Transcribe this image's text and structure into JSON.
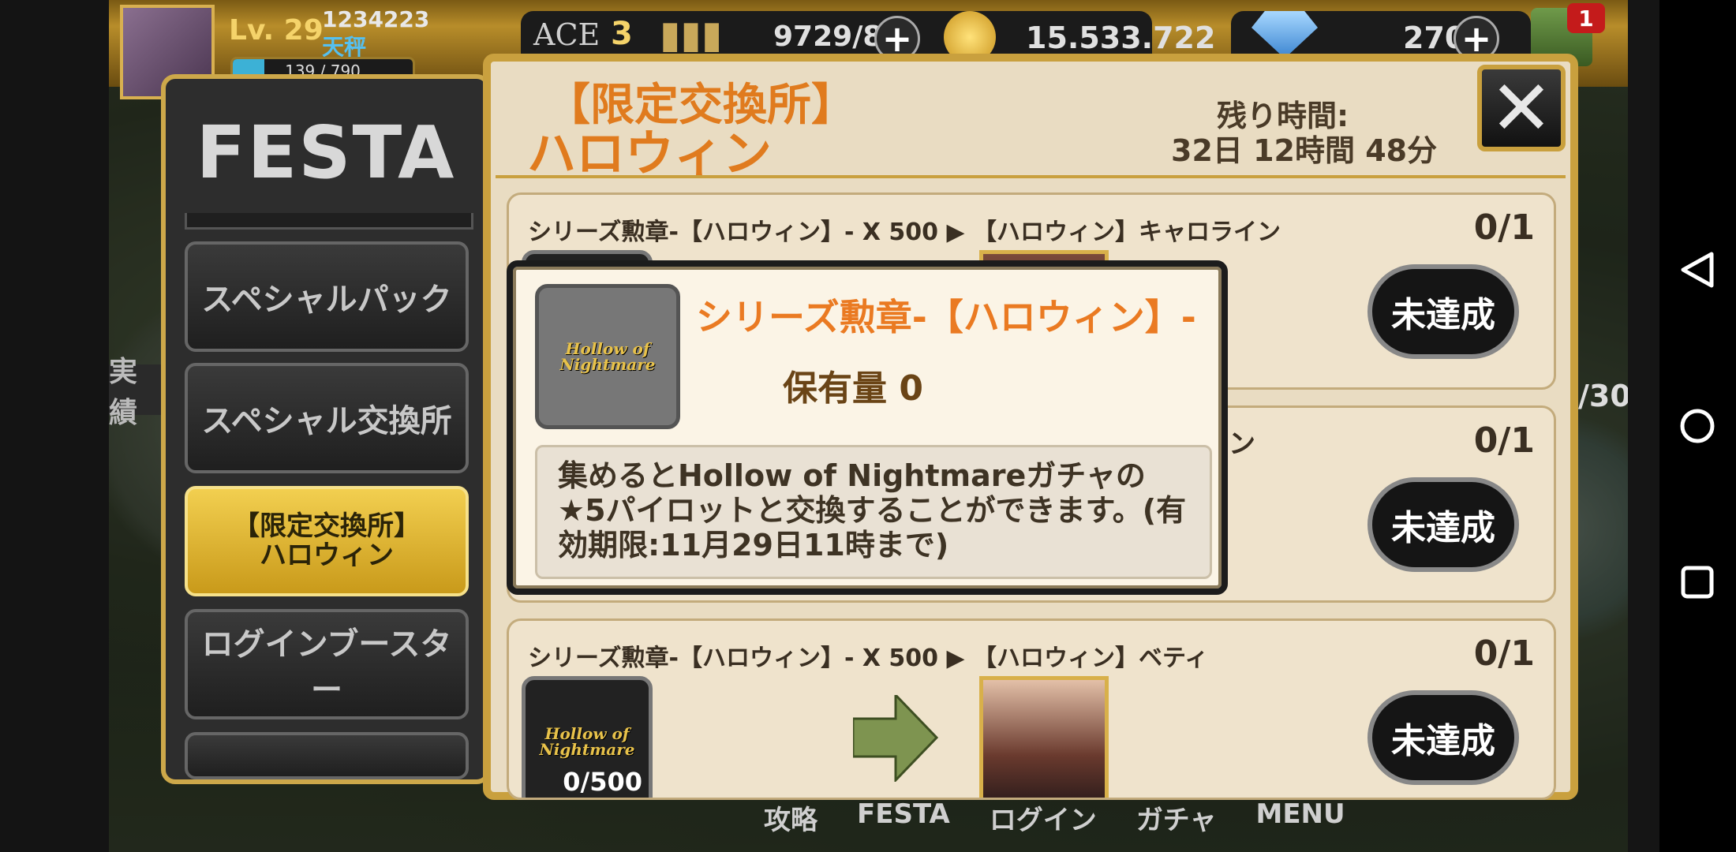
{
  "player": {
    "level": "Lv. 29",
    "id": "1234223",
    "name": "天秤",
    "exp": "139 / 790"
  },
  "topbar": {
    "ace_label": "ACE",
    "ace_value": "3",
    "ammo": "9729/88",
    "coins": "15.533.722",
    "gems": "270",
    "army_badge": "1"
  },
  "festa": {
    "title": "FESTA",
    "menu": [
      {
        "label": "スペシャルパック"
      },
      {
        "label": "スペシャル交換所"
      },
      {
        "label": "【限定交換所】\nハロウィン"
      },
      {
        "label": "ログインブースター"
      }
    ]
  },
  "background": {
    "left_partial_text": "実績",
    "right_partial_text": "/30"
  },
  "dialog": {
    "title_line1": "【限定交換所】",
    "title_line2": "ハロウィン",
    "remaining_label": "残り時間:",
    "remaining_value": "32日 12時間 48分",
    "rows": [
      {
        "title": "シリーズ勲章-【ハロウィン】- X 500 ▶ 【ハロウィン】キャロライン",
        "count": "0/1",
        "status": "未達成"
      },
      {
        "title_partial": "ン",
        "count": "0/1",
        "status": "未達成"
      },
      {
        "title": "シリーズ勲章-【ハロウィン】- X 500 ▶ 【ハロウィン】ベティ",
        "count": "0/1",
        "status": "未達成",
        "medal_progress": "0/500"
      }
    ]
  },
  "popup": {
    "item_name": "シリーズ勲章-【ハロウィン】-",
    "held_label": "保有量 0",
    "medal_logo_line1": "Hollow of",
    "medal_logo_line2": "Nightmare",
    "description": "集めるとHollow of Nightmareガチャの★5パイロットと交換することができます。(有効期限:11月29日11時まで)"
  },
  "bottom_tabs": [
    "攻略",
    "FESTA",
    "ログイン",
    "ガチャ",
    "MENU"
  ]
}
